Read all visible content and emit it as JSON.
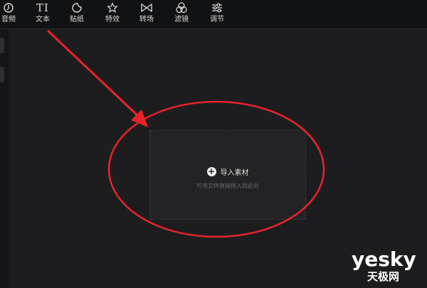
{
  "toolbar": {
    "items": [
      {
        "label": "音频",
        "icon": "music-icon"
      },
      {
        "label": "文本",
        "icon": "text-icon",
        "glyph": "TI"
      },
      {
        "label": "贴纸",
        "icon": "sticker-icon"
      },
      {
        "label": "特效",
        "icon": "effects-star-icon"
      },
      {
        "label": "转场",
        "icon": "transition-bowtie-icon"
      },
      {
        "label": "滤镜",
        "icon": "filter-circles-icon"
      },
      {
        "label": "调节",
        "icon": "adjust-sliders-icon"
      }
    ]
  },
  "dropzone": {
    "import_label": "导入素材",
    "hint": "可将文件直接拖入到此处"
  },
  "watermark": {
    "brand": "yesky",
    "brand_cn": "天极网"
  },
  "annotation": {
    "color": "#e8232a"
  }
}
